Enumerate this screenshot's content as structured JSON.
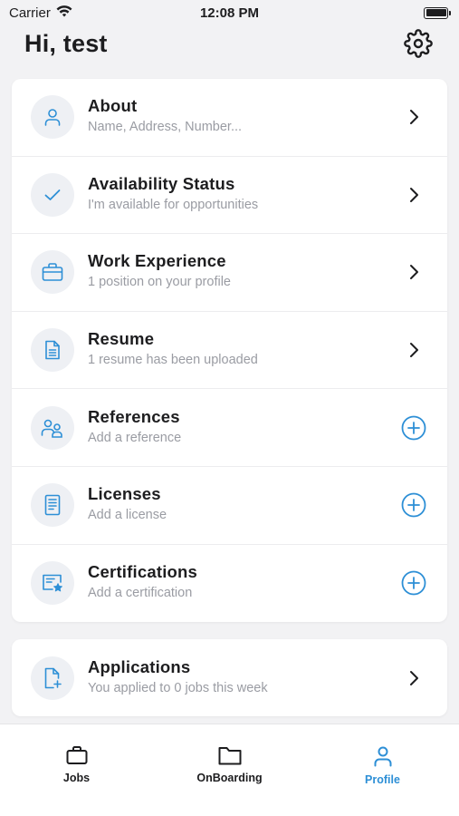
{
  "status_bar": {
    "carrier": "Carrier",
    "time": "12:08 PM"
  },
  "header": {
    "greeting": "Hi, test"
  },
  "colors": {
    "accent": "#2d8fd6",
    "icon_bg": "#eef0f4",
    "subtitle": "#9a9ca3"
  },
  "profile_items": [
    {
      "title": "About",
      "subtitle": "Name, Address, Number...",
      "icon": "user-icon",
      "action": "chevron-right-icon"
    },
    {
      "title": "Availability Status",
      "subtitle": "I'm available for opportunities",
      "icon": "checkmark-icon",
      "action": "chevron-right-icon"
    },
    {
      "title": "Work Experience",
      "subtitle": "1 position on your profile",
      "icon": "briefcase-icon",
      "action": "chevron-right-icon"
    },
    {
      "title": "Resume",
      "subtitle": "1 resume has been uploaded",
      "icon": "document-icon",
      "action": "chevron-right-icon"
    },
    {
      "title": "References",
      "subtitle": "Add a reference",
      "icon": "people-icon",
      "action": "plus-circle-icon"
    },
    {
      "title": "Licenses",
      "subtitle": "Add a license",
      "icon": "license-icon",
      "action": "plus-circle-icon"
    },
    {
      "title": "Certifications",
      "subtitle": "Add a certification",
      "icon": "certificate-icon",
      "action": "plus-circle-icon"
    }
  ],
  "applications": {
    "title": "Applications",
    "subtitle": "You applied to 0 jobs this week",
    "icon": "file-add-icon",
    "action": "chevron-right-icon"
  },
  "tabs": [
    {
      "label": "Jobs",
      "icon": "briefcase-icon",
      "active": false
    },
    {
      "label": "OnBoarding",
      "icon": "folder-icon",
      "active": false
    },
    {
      "label": "Profile",
      "icon": "user-icon",
      "active": true
    }
  ]
}
